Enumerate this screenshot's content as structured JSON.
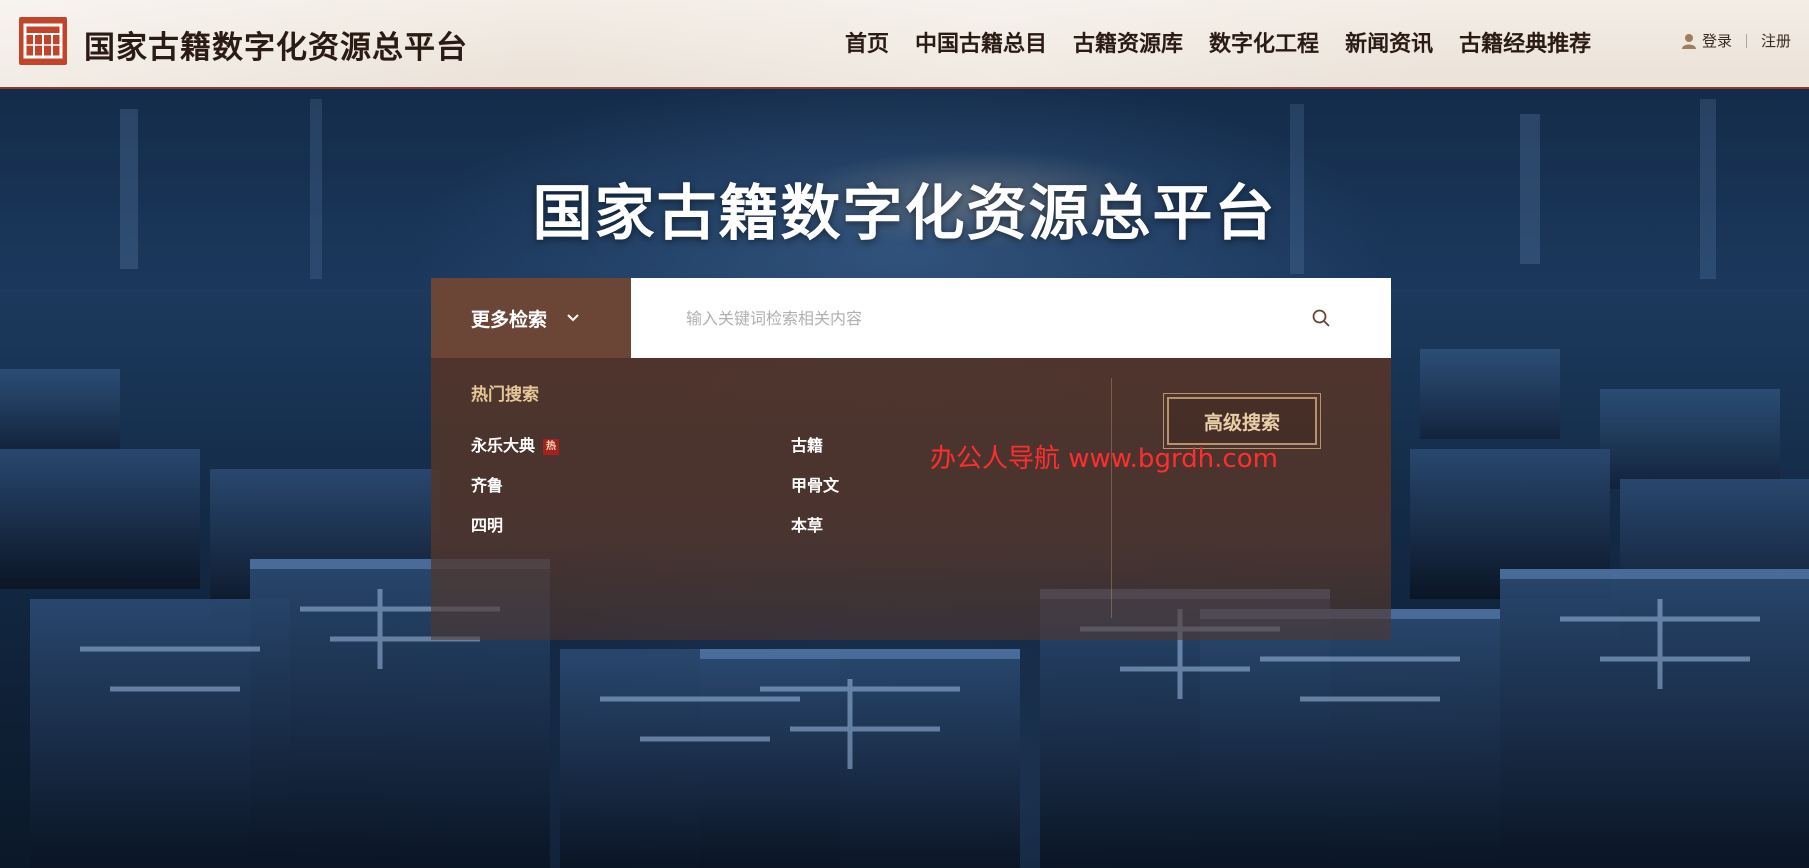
{
  "header": {
    "site_title": "国家古籍数字化资源总平台",
    "nav": [
      "首页",
      "中国古籍总目",
      "古籍资源库",
      "数字化工程",
      "新闻资讯",
      "古籍经典推荐"
    ],
    "login": "登录",
    "register": "注册"
  },
  "hero": {
    "title": "国家古籍数字化资源总平台"
  },
  "search": {
    "more_label": "更多检索",
    "placeholder": "输入关键词检索相关内容"
  },
  "hot": {
    "title": "热门搜索",
    "badge": "热",
    "items": [
      "永乐大典",
      "古籍",
      "齐鲁",
      "甲骨文",
      "四明",
      "本草"
    ]
  },
  "advanced_label": "高级搜索",
  "watermark": "办公人导航 www.bgrdh.com",
  "colors": {
    "brand_red": "#c2452b",
    "panel_brown": "#6b4536",
    "hot_title": "#e7c79a",
    "badge_red": "#a3231c",
    "watermark": "#ff2d2d"
  }
}
